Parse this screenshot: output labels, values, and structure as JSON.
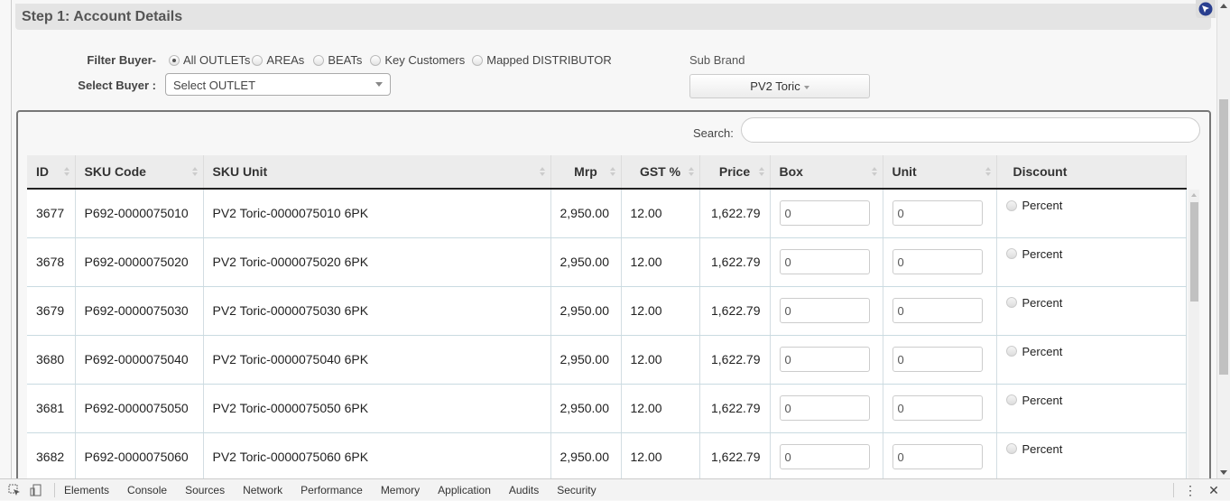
{
  "step": {
    "title": "Step 1: Account Details"
  },
  "filter": {
    "label": "Filter Buyer-",
    "options": [
      {
        "label": "All OUTLETs",
        "checked": true
      },
      {
        "label": "AREAs",
        "checked": false
      },
      {
        "label": "BEATs",
        "checked": false
      },
      {
        "label": "Key Customers",
        "checked": false
      },
      {
        "label": "Mapped DISTRIBUTOR",
        "checked": false
      }
    ]
  },
  "select_buyer": {
    "label": "Select Buyer :",
    "value": "Select OUTLET"
  },
  "sub_brand": {
    "label": "Sub Brand",
    "value": "PV2 Toric"
  },
  "search": {
    "label": "Search:",
    "value": ""
  },
  "table": {
    "columns": [
      "ID",
      "SKU Code",
      "SKU Unit",
      "Mrp",
      "GST %",
      "Price",
      "Box",
      "Unit",
      "Discount"
    ],
    "rows": [
      {
        "id": "3677",
        "sku_code": "P692-0000075010",
        "sku_unit": "PV2 Toric-0000075010 6PK",
        "mrp": "2,950.00",
        "gst": "12.00",
        "price": "1,622.79",
        "box": "0",
        "unit": "0",
        "discount": "Percent"
      },
      {
        "id": "3678",
        "sku_code": "P692-0000075020",
        "sku_unit": "PV2 Toric-0000075020 6PK",
        "mrp": "2,950.00",
        "gst": "12.00",
        "price": "1,622.79",
        "box": "0",
        "unit": "0",
        "discount": "Percent"
      },
      {
        "id": "3679",
        "sku_code": "P692-0000075030",
        "sku_unit": "PV2 Toric-0000075030 6PK",
        "mrp": "2,950.00",
        "gst": "12.00",
        "price": "1,622.79",
        "box": "0",
        "unit": "0",
        "discount": "Percent"
      },
      {
        "id": "3680",
        "sku_code": "P692-0000075040",
        "sku_unit": "PV2 Toric-0000075040 6PK",
        "mrp": "2,950.00",
        "gst": "12.00",
        "price": "1,622.79",
        "box": "0",
        "unit": "0",
        "discount": "Percent"
      },
      {
        "id": "3681",
        "sku_code": "P692-0000075050",
        "sku_unit": "PV2 Toric-0000075050 6PK",
        "mrp": "2,950.00",
        "gst": "12.00",
        "price": "1,622.79",
        "box": "0",
        "unit": "0",
        "discount": "Percent"
      },
      {
        "id": "3682",
        "sku_code": "P692-0000075060",
        "sku_unit": "PV2 Toric-0000075060 6PK",
        "mrp": "2,950.00",
        "gst": "12.00",
        "price": "1,622.79",
        "box": "0",
        "unit": "0",
        "discount": "Percent"
      }
    ]
  },
  "devtools": {
    "tabs": [
      "Elements",
      "Console",
      "Sources",
      "Network",
      "Performance",
      "Memory",
      "Application",
      "Audits",
      "Security"
    ],
    "icons": [
      "inspect-element-icon",
      "device-toolbar-icon",
      "more-options-icon",
      "close-icon"
    ]
  }
}
